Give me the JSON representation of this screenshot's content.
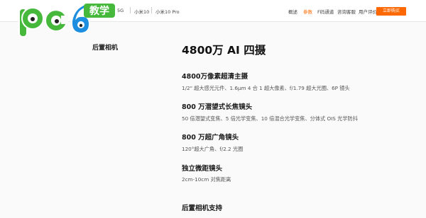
{
  "nav": {
    "product": "5G",
    "models": [
      "小米10",
      "小米10 Pro"
    ],
    "links": [
      "概述",
      "参数",
      "F码通道",
      "咨询客服",
      "用户评价"
    ],
    "active_link": "参数",
    "buy_label": "立即购买"
  },
  "logo": {
    "text": "pc6",
    "badge": "教学"
  },
  "section": {
    "side_title": "后置相机",
    "headline": "4800万 AI 四摄",
    "features": [
      {
        "title": "4800万像素超清主摄",
        "desc": "1/2\" 超大感光元件、1.6μm 4 合 1 超大像素、f/1.79 超大光圈、6P 镜头"
      },
      {
        "title": "800 万潜望式长焦镜头",
        "desc": "50 倍潜望式变焦、5 倍光学变焦、10 倍混合光学变焦、分体式 OIS 光学防抖"
      },
      {
        "title": "800 万超广角镜头",
        "desc": "120°超大广角、f/2.2 光圈"
      },
      {
        "title": "独立微距镜头",
        "desc": "2cm-10cm 对焦距离"
      },
      {
        "title": "后置相机支持",
        "desc": ""
      }
    ]
  },
  "colors": {
    "accent": "#ff6700",
    "logo_green": "#46b93c",
    "logo_blue": "#1e8fe0"
  }
}
